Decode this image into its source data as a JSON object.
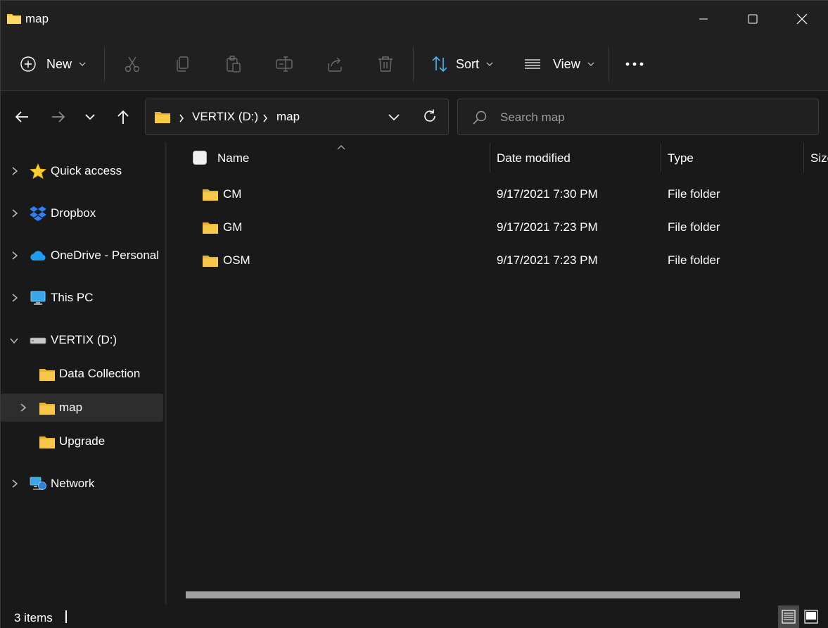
{
  "window": {
    "title": "map",
    "minimize_icon": "minimize-icon",
    "maximize_icon": "maximize-icon",
    "close_icon": "close-icon"
  },
  "toolbar": {
    "new_label": "New",
    "sort_label": "Sort",
    "view_label": "View",
    "icons": [
      "cut-icon",
      "copy-icon",
      "paste-icon",
      "rename-icon",
      "share-icon",
      "delete-icon",
      "more-icon"
    ]
  },
  "address": {
    "crumbs": [
      "VERTIX (D:)",
      "map"
    ],
    "search_placeholder": "Search map"
  },
  "navpane": {
    "items": [
      {
        "label": "Quick access",
        "icon": "star-icon"
      },
      {
        "label": "Dropbox",
        "icon": "dropbox-icon"
      },
      {
        "label": "OneDrive - Personal",
        "icon": "onedrive-icon"
      },
      {
        "label": "This PC",
        "icon": "pc-icon"
      },
      {
        "label": "VERTIX (D:)",
        "icon": "drive-icon"
      },
      {
        "label": "Data Collection",
        "icon": "folder-icon"
      },
      {
        "label": "map",
        "icon": "folder-icon"
      },
      {
        "label": "Upgrade",
        "icon": "folder-icon"
      },
      {
        "label": "Network",
        "icon": "network-icon"
      }
    ]
  },
  "filelist": {
    "columns": [
      "Name",
      "Date modified",
      "Type",
      "Size"
    ],
    "rows": [
      {
        "name": "CM",
        "date": "9/17/2021 7:30 PM",
        "type": "File folder"
      },
      {
        "name": "GM",
        "date": "9/17/2021 7:23 PM",
        "type": "File folder"
      },
      {
        "name": "OSM",
        "date": "9/17/2021 7:23 PM",
        "type": "File folder"
      }
    ]
  },
  "status": {
    "items_text": "3 items"
  },
  "colors": {
    "folder": "#f8c948",
    "background": "#191919",
    "accent": "#4cc2ff"
  }
}
